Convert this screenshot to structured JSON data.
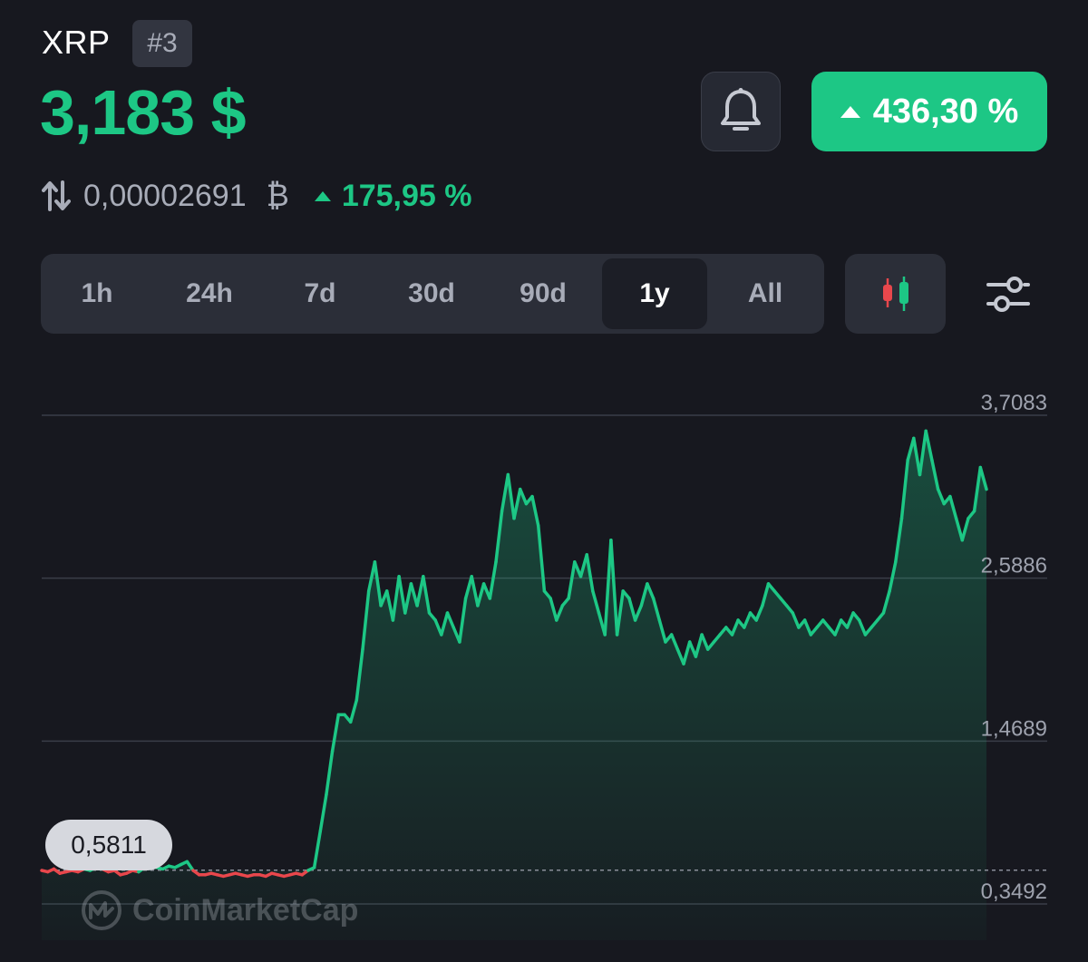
{
  "coin": {
    "name": "XRP",
    "rank": "#3",
    "price": "3,183 $",
    "change_percent": "436,30 %",
    "btc_price": "0,00002691",
    "btc_symbol": "₿",
    "btc_change": "175,95 %"
  },
  "colors": {
    "up": "#1dc785",
    "down": "#e8474c",
    "background": "#17181f"
  },
  "icons": {
    "alert": "bell-icon",
    "pair": "swap-arrows-icon",
    "chart_type": "candlestick-icon",
    "settings": "sliders-icon",
    "watermark": "coinmarketcap-logo-icon"
  },
  "time_ranges": [
    {
      "label": "1h",
      "active": false
    },
    {
      "label": "24h",
      "active": false
    },
    {
      "label": "7d",
      "active": false
    },
    {
      "label": "30d",
      "active": false
    },
    {
      "label": "90d",
      "active": false
    },
    {
      "label": "1y",
      "active": true
    },
    {
      "label": "All",
      "active": false
    }
  ],
  "watermark": "CoinMarketCap",
  "chart_data": {
    "type": "area",
    "title": "",
    "xlabel": "",
    "ylabel": "",
    "y_ticks": [
      "3,7083",
      "2,5886",
      "1,4689",
      "0,3492"
    ],
    "y_tick_values": [
      3.7083,
      2.5886,
      1.4689,
      0.3492
    ],
    "ylim": [
      0.3492,
      3.7083
    ],
    "baseline_value": 0.5811,
    "baseline_label": "0,5811",
    "grid": true,
    "x_range": [
      0,
      1
    ],
    "series": [
      {
        "values": [
          0.58,
          0.57,
          0.59,
          0.56,
          0.57,
          0.58,
          0.57,
          0.59,
          0.58,
          0.6,
          0.59,
          0.57,
          0.58,
          0.55,
          0.56,
          0.58,
          0.57,
          0.6,
          0.62,
          0.6,
          0.59,
          0.61,
          0.6,
          0.62,
          0.64,
          0.58,
          0.55,
          0.55,
          0.56,
          0.55,
          0.54,
          0.55,
          0.56,
          0.55,
          0.54,
          0.55,
          0.55,
          0.54,
          0.56,
          0.55,
          0.54,
          0.55,
          0.56,
          0.55,
          0.58,
          0.6,
          0.85,
          1.1,
          1.4,
          1.65,
          1.65,
          1.6,
          1.75,
          2.1,
          2.5,
          2.7,
          2.4,
          2.5,
          2.3,
          2.6,
          2.35,
          2.55,
          2.4,
          2.6,
          2.35,
          2.3,
          2.2,
          2.35,
          2.25,
          2.15,
          2.45,
          2.6,
          2.4,
          2.55,
          2.45,
          2.7,
          3.05,
          3.3,
          3.0,
          3.2,
          3.1,
          3.15,
          2.95,
          2.5,
          2.45,
          2.3,
          2.4,
          2.45,
          2.7,
          2.6,
          2.75,
          2.5,
          2.35,
          2.2,
          2.85,
          2.2,
          2.5,
          2.45,
          2.3,
          2.4,
          2.55,
          2.45,
          2.3,
          2.15,
          2.2,
          2.1,
          2.0,
          2.15,
          2.05,
          2.2,
          2.1,
          2.15,
          2.2,
          2.25,
          2.2,
          2.3,
          2.25,
          2.35,
          2.3,
          2.4,
          2.55,
          2.5,
          2.45,
          2.4,
          2.35,
          2.25,
          2.3,
          2.2,
          2.25,
          2.3,
          2.25,
          2.2,
          2.3,
          2.25,
          2.35,
          2.3,
          2.2,
          2.25,
          2.3,
          2.35,
          2.5,
          2.7,
          3.0,
          3.4,
          3.55,
          3.3,
          3.6,
          3.4,
          3.2,
          3.1,
          3.15,
          3.0,
          2.85,
          3.0,
          3.05,
          3.35,
          3.2
        ],
        "color": "#1dc785"
      }
    ]
  }
}
